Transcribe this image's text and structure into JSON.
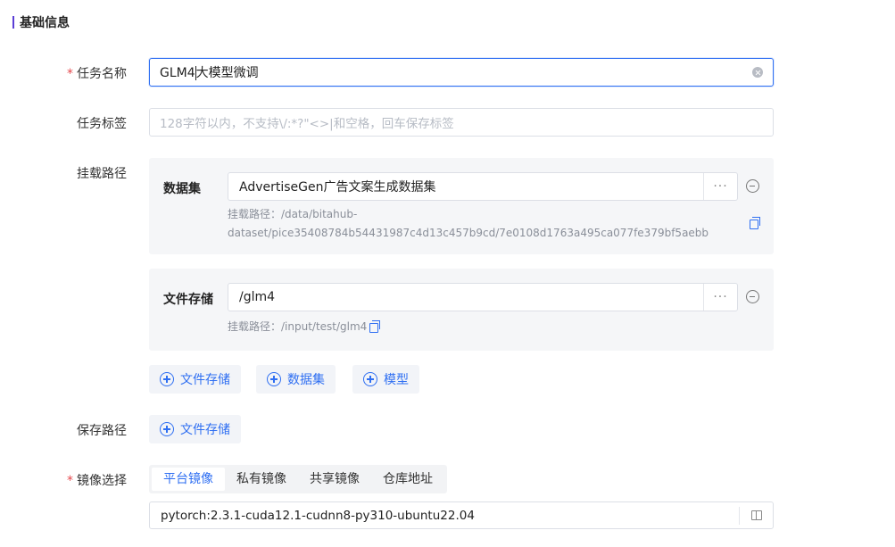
{
  "section": {
    "title": "基础信息"
  },
  "task_name": {
    "label": "任务名称",
    "required_mark": "*",
    "value_before_caret": "GLM4",
    "value_after_caret": "大模型微调"
  },
  "task_tags": {
    "label": "任务标签",
    "placeholder": "128字符以内，不支持\\/:*?\"<>|和空格，回车保存标签"
  },
  "mount": {
    "label": "挂载路径",
    "items": [
      {
        "name": "数据集",
        "value": "AdvertiseGen广告文案生成数据集",
        "more": "···",
        "path_line1": "挂载路径：/data/bitahub-",
        "path_line2": "dataset/pice35408784b54431987c4d13c457b9cd/7e0108d1763a495ca077fe379bf5aebb"
      },
      {
        "name": "文件存储",
        "value": "/glm4",
        "more": "···",
        "path_line1": "挂载路径：/input/test/glm4"
      }
    ],
    "add_buttons": [
      "文件存储",
      "数据集",
      "模型"
    ]
  },
  "save_path": {
    "label": "保存路径",
    "add_button": "文件存储"
  },
  "image_select": {
    "label": "镜像选择",
    "required_mark": "*",
    "tabs": [
      "平台镜像",
      "私有镜像",
      "共享镜像",
      "仓库地址"
    ],
    "active_tab": "平台镜像",
    "value": "pytorch:2.3.1-cuda12.1-cudnn8-py310-ubuntu22.04"
  },
  "colors": {
    "accent": "#2f6ff2",
    "section_bar": "#5b3fd6",
    "required": "#e5484d",
    "card_bg": "#f5f6f8"
  }
}
